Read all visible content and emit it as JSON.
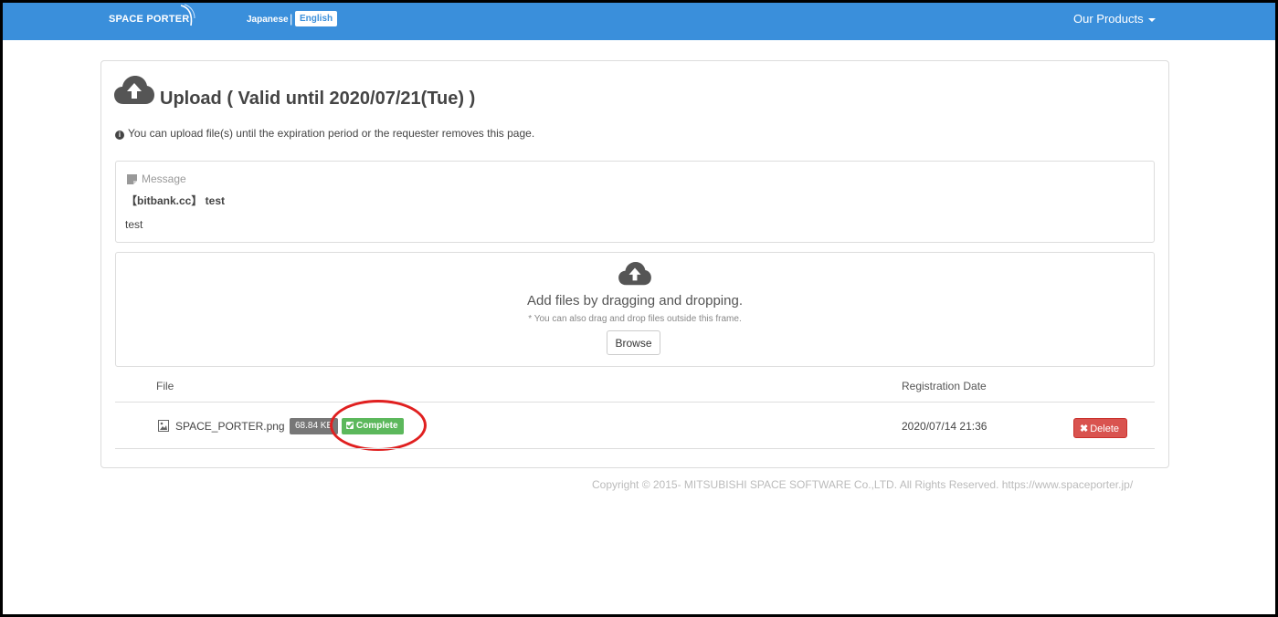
{
  "navbar": {
    "logo": "SPACE PORTER",
    "lang_japanese": "Japanese",
    "lang_separator": "|",
    "lang_english": "English",
    "our_products": "Our Products"
  },
  "upload": {
    "title": "Upload ( Valid until 2020/07/21(Tue) )",
    "info": "You can upload file(s) until the expiration period or the requester removes this page."
  },
  "message": {
    "label": "Message",
    "subject": "【bitbank.cc】 test",
    "body": "test"
  },
  "dropzone": {
    "text": "Add files by dragging and dropping.",
    "subtext": "* You can also drag and drop files outside this frame.",
    "browse_label": "Browse"
  },
  "table": {
    "headers": {
      "file": "File",
      "registration_date": "Registration Date"
    },
    "rows": [
      {
        "file_name": "SPACE_PORTER.png",
        "size": "68.84 KB",
        "status": "Complete",
        "registration_date": "2020/07/14 21:36",
        "delete_label": "Delete"
      }
    ]
  },
  "footer": {
    "copyright": "Copyright © 2015- MITSUBISHI SPACE SOFTWARE Co.,LTD. All Rights Reserved. https://www.spaceporter.jp/"
  },
  "colors": {
    "navbar": "#3a8fdb",
    "complete": "#5cb85c",
    "delete": "#d9534f",
    "highlight": "#e02020"
  }
}
